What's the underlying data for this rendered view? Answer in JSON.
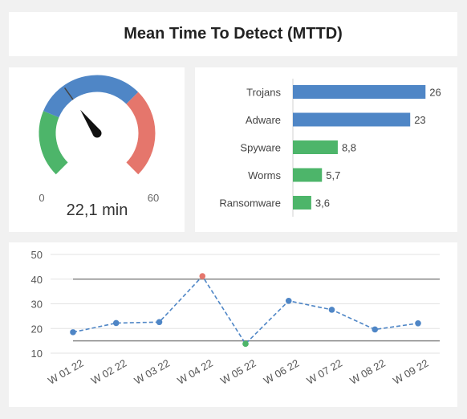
{
  "title": "Mean Time To Detect (MTTD)",
  "colors": {
    "blue": "#4f86c6",
    "green": "#4db56a",
    "red": "#e5766c",
    "threshold": "#888888"
  },
  "gauge": {
    "min_label": "0",
    "max_label": "60",
    "value_label": "22,1 min",
    "value": 22.1,
    "min": 0,
    "max": 60,
    "bands": [
      {
        "from": 0,
        "to": 15,
        "color": "#4db56a"
      },
      {
        "from": 15,
        "to": 40,
        "color": "#4f86c6"
      },
      {
        "from": 40,
        "to": 60,
        "color": "#e5766c"
      }
    ]
  },
  "chart_data": [
    {
      "type": "bar",
      "orientation": "horizontal",
      "categories": [
        "Trojans",
        "Adware",
        "Spyware",
        "Worms",
        "Ransomware"
      ],
      "values": [
        26,
        23,
        8.8,
        5.7,
        3.6
      ],
      "value_labels": [
        "26",
        "23",
        "8,8",
        "5,7",
        "3,6"
      ],
      "colors": [
        "#4f86c6",
        "#4f86c6",
        "#4db56a",
        "#4db56a",
        "#4db56a"
      ],
      "xlim": [
        0,
        28
      ]
    },
    {
      "type": "line",
      "categories": [
        "W 01 22",
        "W 02 22",
        "W 03 22",
        "W 04 22",
        "W 05 22",
        "W 06 22",
        "W 07 22",
        "W 08 22",
        "W 09 22"
      ],
      "values": [
        18.5,
        22.2,
        22.6,
        41.2,
        13.8,
        31.2,
        27.6,
        19.6,
        22.1
      ],
      "point_colors": [
        "#4f86c6",
        "#4f86c6",
        "#4f86c6",
        "#e5766c",
        "#4db56a",
        "#4f86c6",
        "#4f86c6",
        "#4f86c6",
        "#4f86c6"
      ],
      "yticks": [
        "10",
        "20",
        "30",
        "40",
        "50"
      ],
      "ylim": [
        10,
        50
      ],
      "thresholds": [
        40,
        15
      ],
      "grid": true,
      "line_style": "dashed"
    }
  ]
}
